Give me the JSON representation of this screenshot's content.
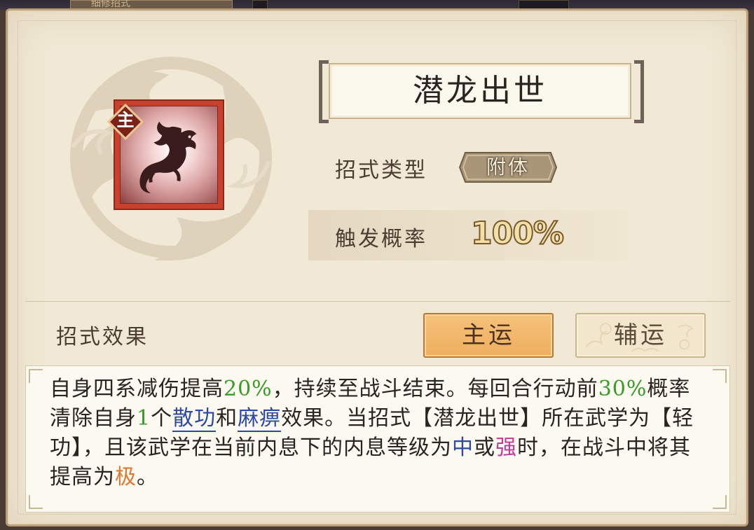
{
  "top_bar": {
    "partial_tab_text": "细修招式"
  },
  "skill": {
    "name": "潜龙出世",
    "role_badge": "主",
    "icon": "dragon-icon"
  },
  "attributes": {
    "type_label": "招式类型",
    "type_value": "附体",
    "trigger_label": "触发概率",
    "trigger_value": "100%"
  },
  "effect_section": {
    "label": "招式效果",
    "main_button": "主运",
    "sub_button": "辅运",
    "active_tab": "主运"
  },
  "description": {
    "s1": "自身四系减伤提高",
    "v1": "20%",
    "s2": "，持续至战斗结束。每回合行动前",
    "v2": "30%",
    "s3": "概率清除自身",
    "v3": "1",
    "s4": "个",
    "link1": "散功",
    "s5": "和",
    "link2": "麻痹",
    "s6": "效果。当招式【潜龙出世】所在武学为【轻功】，且该武学在当前内息下的内息等级为",
    "lv1": "中",
    "s7": "或",
    "lv2": "强",
    "s8": "时，在战斗中将其提高为",
    "lv3": "极",
    "s9": "。"
  },
  "colors": {
    "highlight_green": "#3a9a2a",
    "highlight_blue": "#2c4aa0",
    "highlight_pink": "#c03a9a",
    "highlight_orange": "#e07830",
    "icon_frame": "#c9402c"
  }
}
